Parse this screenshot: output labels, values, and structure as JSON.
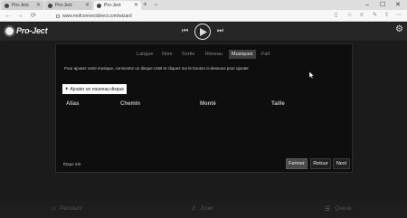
{
  "browser": {
    "tabs": [
      {
        "title": "Pro-Ject",
        "active": false
      },
      {
        "title": "Pro-Ject",
        "active": false
      },
      {
        "title": "Pro-Ject",
        "active": true
      }
    ],
    "new_tab_label": "+",
    "tab_menu_label": "⌄",
    "window_controls": {
      "minimize": "–",
      "maximize": "☐",
      "close": "✕"
    },
    "nav": {
      "back": "←",
      "forward": "→",
      "refresh": "⟳"
    },
    "url": "www.mofconnectdirect.com/wizard"
  },
  "app": {
    "logo_text": "Pro-Ject",
    "icons": {
      "prev": "⏮",
      "next": "⏭",
      "settings": "⚙"
    }
  },
  "footer": {
    "items": [
      {
        "label": "Parcourir",
        "icon": "⌂"
      },
      {
        "label": "Jouer",
        "icon": "♫"
      },
      {
        "label": "Queue",
        "icon": "☰"
      }
    ]
  },
  "wizard": {
    "steps": [
      "Langue",
      "Nom",
      "Sortie",
      "Réseau",
      "Musiques",
      "Fait"
    ],
    "active_step": 4,
    "instruction": "Pour ajouter votre musique, connectez un disque USB et cliquez sur le bouton ci-dessous pour ajouter",
    "add_button_label": "Ajouter un nouveau disque",
    "add_button_icon": "+",
    "table_headers": [
      "Alias",
      "Chemin",
      "Monté",
      "Taille"
    ],
    "step_counter": "Étape 5/6",
    "buttons": {
      "close": "Fermer",
      "back": "Retour",
      "next": "Next"
    }
  },
  "colors": {
    "modal_bg": "#0e0e0e",
    "page_bg": "#1b1b1b",
    "active_step": "#3d3d3d"
  }
}
